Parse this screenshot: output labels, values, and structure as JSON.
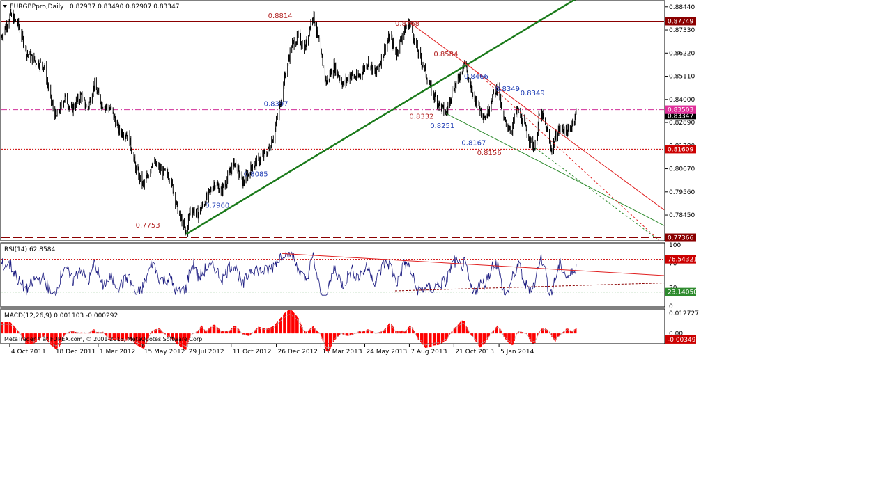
{
  "header": {
    "symbol_label": "EURGBPpro,Daily",
    "ohlc": "0.82937 0.83490 0.82907 0.83347"
  },
  "rsi_header": {
    "label": "RSI(14) 62.8584"
  },
  "macd_header": {
    "label": "MACD(12,26,9) 0.001103 -0.000292"
  },
  "footer": {
    "copyright": "MetaTrader 4 at FOREX.com, © 2001-2013, MetaQuotes Software Corp."
  },
  "chart_data": [
    {
      "type": "candlestick",
      "panel": "price",
      "symbol": "EURGBPpro",
      "timeframe": "Daily",
      "ylim": [
        0.7725,
        0.887
      ],
      "y_ticks": [
        "0.88440",
        "0.87330",
        "0.86220",
        "0.85110",
        "0.84000",
        "0.82890",
        "0.81780",
        "0.80670",
        "0.79560",
        "0.78450"
      ],
      "x_ticks": [
        "4 Oct 2011",
        "18 Dec 2011",
        "1 Mar 2012",
        "15 May 2012",
        "29 Jul 2012",
        "11 Oct 2012",
        "26 Dec 2012",
        "11 Mar 2013",
        "24 May 2013",
        "7 Aug 2013",
        "21 Oct 2013",
        "5 Jan 2014"
      ],
      "x_range": [
        "2011-09-20",
        "2014-10-10"
      ],
      "close_path": [
        [
          "2011-09-20",
          0.87
        ],
        [
          "2011-10-05",
          0.8805
        ],
        [
          "2011-10-18",
          0.876
        ],
        [
          "2011-11-02",
          0.862
        ],
        [
          "2011-11-18",
          0.858
        ],
        [
          "2011-12-01",
          0.856
        ],
        [
          "2011-12-12",
          0.84
        ],
        [
          "2011-12-21",
          0.831
        ],
        [
          "2012-01-05",
          0.841
        ],
        [
          "2012-01-16",
          0.835
        ],
        [
          "2012-02-01",
          0.842
        ],
        [
          "2012-02-12",
          0.835
        ],
        [
          "2012-02-23",
          0.847
        ],
        [
          "2012-03-07",
          0.838
        ],
        [
          "2012-03-23",
          0.835
        ],
        [
          "2012-04-05",
          0.825
        ],
        [
          "2012-04-21",
          0.823
        ],
        [
          "2012-05-04",
          0.806
        ],
        [
          "2012-05-17",
          0.798
        ],
        [
          "2012-05-31",
          0.81
        ],
        [
          "2012-06-14",
          0.806
        ],
        [
          "2012-06-30",
          0.803
        ],
        [
          "2012-07-12",
          0.788
        ],
        [
          "2012-07-23",
          0.779
        ],
        [
          "2012-07-27",
          0.7753
        ],
        [
          "2012-08-03",
          0.788
        ],
        [
          "2012-08-16",
          0.785
        ],
        [
          "2012-08-30",
          0.792
        ],
        [
          "2012-09-13",
          0.8
        ],
        [
          "2012-09-24",
          0.796
        ],
        [
          "2012-10-05",
          0.802
        ],
        [
          "2012-10-16",
          0.81
        ],
        [
          "2012-10-31",
          0.8
        ],
        [
          "2012-11-16",
          0.808
        ],
        [
          "2012-11-27",
          0.811
        ],
        [
          "2012-12-11",
          0.815
        ],
        [
          "2012-12-22",
          0.823
        ],
        [
          "2013-01-03",
          0.84
        ],
        [
          "2013-01-12",
          0.855
        ],
        [
          "2013-01-21",
          0.866
        ],
        [
          "2013-02-01",
          0.87
        ],
        [
          "2013-02-12",
          0.864
        ],
        [
          "2013-02-26",
          0.8814
        ],
        [
          "2013-03-09",
          0.865
        ],
        [
          "2013-03-20",
          0.848
        ],
        [
          "2013-04-02",
          0.856
        ],
        [
          "2013-04-18",
          0.847
        ],
        [
          "2013-04-29",
          0.852
        ],
        [
          "2013-05-12",
          0.85
        ],
        [
          "2013-05-29",
          0.858
        ],
        [
          "2013-06-11",
          0.852
        ],
        [
          "2013-06-24",
          0.862
        ],
        [
          "2013-07-05",
          0.87
        ],
        [
          "2013-07-16",
          0.862
        ],
        [
          "2013-07-27",
          0.872
        ],
        [
          "2013-08-08",
          0.8768
        ],
        [
          "2013-08-22",
          0.862
        ],
        [
          "2013-08-31",
          0.856
        ],
        [
          "2013-09-12",
          0.845
        ],
        [
          "2013-09-25",
          0.838
        ],
        [
          "2013-10-08",
          0.8332
        ],
        [
          "2013-10-18",
          0.844
        ],
        [
          "2013-10-29",
          0.85
        ],
        [
          "2013-11-08",
          0.8584
        ],
        [
          "2013-11-19",
          0.844
        ],
        [
          "2013-12-03",
          0.836
        ],
        [
          "2013-12-14",
          0.831
        ],
        [
          "2013-12-23",
          0.84
        ],
        [
          "2014-01-03",
          0.8466
        ],
        [
          "2014-01-12",
          0.83
        ],
        [
          "2014-01-26",
          0.8251
        ],
        [
          "2014-02-04",
          0.835
        ],
        [
          "2014-02-15",
          0.829
        ],
        [
          "2014-02-26",
          0.82
        ],
        [
          "2014-03-07",
          0.8167
        ],
        [
          "2014-03-15",
          0.8349
        ],
        [
          "2014-03-26",
          0.826
        ],
        [
          "2014-04-04",
          0.8156
        ],
        [
          "2014-04-13",
          0.825
        ],
        [
          "2014-04-24",
          0.826
        ],
        [
          "2014-05-03",
          0.824
        ],
        [
          "2014-05-10",
          0.83
        ],
        [
          "2014-05-15",
          0.8335
        ]
      ],
      "price_labels": [
        {
          "text": "0.8814",
          "date": "2012-12-12",
          "price": 0.879,
          "color": "#b22222"
        },
        {
          "text": "0.8768",
          "date": "2013-07-14",
          "price": 0.8753,
          "color": "#b22222"
        },
        {
          "text": "0.8584",
          "date": "2013-09-17",
          "price": 0.8607,
          "color": "#b22222"
        },
        {
          "text": "0.8466",
          "date": "2013-11-07",
          "price": 0.85,
          "color": "#1e3cb4"
        },
        {
          "text": "0.8349",
          "date": "2013-12-30",
          "price": 0.844,
          "color": "#1e3cb4"
        },
        {
          "text": "0.8349",
          "date": "2014-02-10",
          "price": 0.842,
          "color": "#1e3cb4"
        },
        {
          "text": "0.8397",
          "date": "2012-12-05",
          "price": 0.8368,
          "color": "#1e3cb4"
        },
        {
          "text": "0.8332",
          "date": "2013-08-07",
          "price": 0.8307,
          "color": "#b22222"
        },
        {
          "text": "0.8251",
          "date": "2013-09-11",
          "price": 0.8263,
          "color": "#1e3cb4"
        },
        {
          "text": "0.8167",
          "date": "2013-11-03",
          "price": 0.818,
          "color": "#1e3cb4"
        },
        {
          "text": "0.8156",
          "date": "2013-11-29",
          "price": 0.8133,
          "color": "#b22222"
        },
        {
          "text": "0.8085",
          "date": "2012-11-01",
          "price": 0.803,
          "color": "#1e3cb4"
        },
        {
          "text": "0.7960",
          "date": "2012-08-28",
          "price": 0.788,
          "color": "#1e3cb4"
        },
        {
          "text": "0.7753",
          "date": "2012-05-03",
          "price": 0.7785,
          "color": "#b22222"
        }
      ],
      "hlines": [
        {
          "price": 0.87749,
          "label": "0.87749",
          "color": "#8b0000",
          "badge": "#8b0000",
          "style": "solid"
        },
        {
          "price": 0.83503,
          "label": "0.83503",
          "color": "#d0309a",
          "badge": "#e0309a",
          "style": "dashdot"
        },
        {
          "price": 0.81609,
          "label": "0.81609",
          "color": "#cc0000",
          "badge": "#cc0000",
          "style": "dotted"
        },
        {
          "price": 0.77366,
          "label": "0.77366",
          "color": "#8b0000",
          "badge": "#8b0000",
          "style": "longdash"
        }
      ],
      "current_price": {
        "value": 0.83347,
        "label": "0.83347"
      },
      "trendlines": [
        {
          "from": [
            "2012-07-27",
            0.7753
          ],
          "to": [
            "2014-05-25",
            0.89
          ],
          "color": "#1a7a1a",
          "width": 2.5,
          "style": "solid"
        },
        {
          "from": [
            "2013-08-08",
            0.8768
          ],
          "to": [
            "2014-10-10",
            0.787
          ],
          "color": "#e02020",
          "width": 1,
          "style": "solid"
        },
        {
          "from": [
            "2013-10-08",
            0.8332
          ],
          "to": [
            "2014-10-10",
            0.7795
          ],
          "color": "#2e8b2e",
          "width": 1,
          "style": "solid"
        },
        {
          "from": [
            "2013-11-08",
            0.8584
          ],
          "to": [
            "2014-10-01",
            0.7725
          ],
          "color": "#e02020",
          "width": 1,
          "style": "dashed"
        },
        {
          "from": [
            "2014-03-07",
            0.8167
          ],
          "to": [
            "2014-10-01",
            0.7725
          ],
          "color": "#2e8b2e",
          "width": 1,
          "style": "dashed"
        }
      ]
    },
    {
      "type": "line",
      "panel": "rsi",
      "name": "RSI(14)",
      "ylim": [
        0,
        100
      ],
      "y_ticks": [
        "100",
        "70",
        "30",
        "0"
      ],
      "current": 62.8584,
      "levels": [
        {
          "value": 76.54321,
          "label": "76.54321",
          "color": "#cc0000",
          "badge": "#cc0000"
        },
        {
          "value": 23.1405,
          "label": "23.14050",
          "color": "#2e8b2e",
          "badge": "#2e8b2e"
        }
      ],
      "trendlines": [
        {
          "from": [
            "2013-01-05",
            86
          ],
          "to": [
            "2014-10-10",
            50
          ],
          "color": "#e02020",
          "style": "solid"
        },
        {
          "from": [
            "2013-07-14",
            25
          ],
          "to": [
            "2014-10-10",
            38
          ],
          "color": "#8b0000",
          "style": "dashed"
        }
      ]
    },
    {
      "type": "histogram",
      "panel": "macd",
      "name": "MACD(12,26,9)",
      "ylim": [
        -0.0055,
        0.0127
      ],
      "y_ticks": [
        "0.012727",
        "0.00"
      ],
      "main": 0.001103,
      "signal": -0.000292,
      "badge": {
        "value": -0.00349,
        "label": "-0.00349",
        "color": "#cc0000"
      }
    }
  ]
}
